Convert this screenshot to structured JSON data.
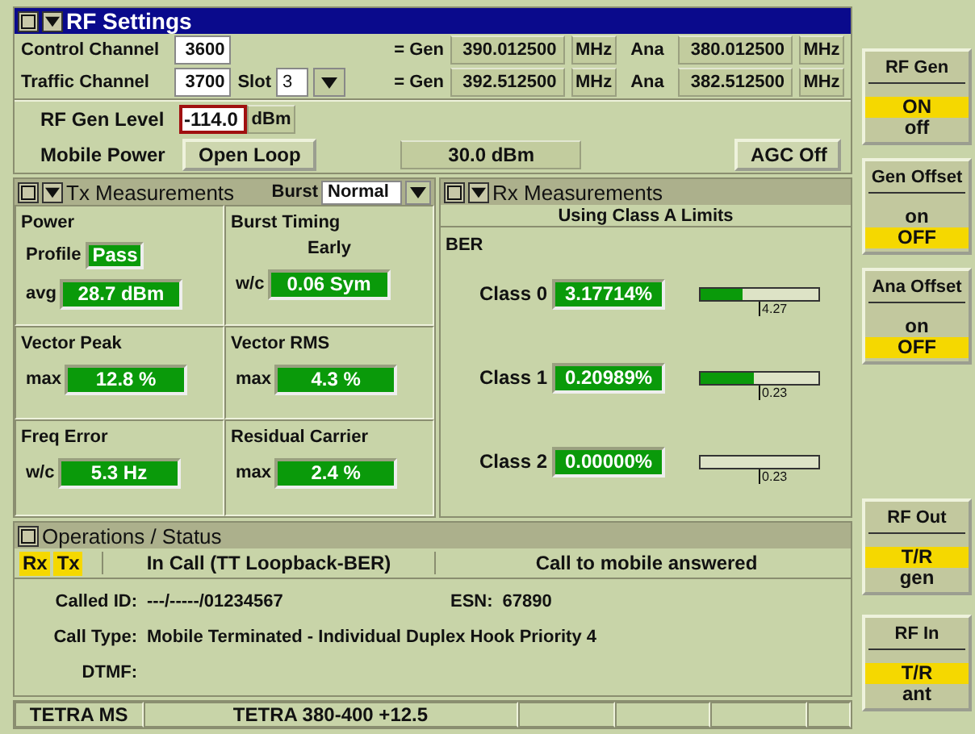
{
  "rf_settings": {
    "title": "RF Settings",
    "channels": [
      {
        "label": "Control Channel",
        "channel": "3600",
        "gen_label": "= Gen",
        "gen": "390.012500",
        "gen_unit": "MHz",
        "ana_label": "Ana",
        "ana": "380.012500",
        "ana_unit": "MHz"
      },
      {
        "label": "Traffic Channel",
        "channel": "3700",
        "slot_label": "Slot",
        "slot": "3",
        "gen_label": "= Gen",
        "gen": "392.512500",
        "gen_unit": "MHz",
        "ana_label": "Ana",
        "ana": "382.512500",
        "ana_unit": "MHz"
      }
    ],
    "gen_level": {
      "label": "RF Gen Level",
      "value": "-114.0",
      "unit": "dBm"
    },
    "mobile_power": {
      "label": "Mobile Power",
      "mode": "Open Loop",
      "reading": "30.0 dBm"
    },
    "agc_button": "AGC Off"
  },
  "tx": {
    "title": "Tx Measurements",
    "burst_label": "Burst",
    "burst": "Normal",
    "cells": [
      {
        "title": "Power",
        "lines": [
          {
            "kind": "badge",
            "label": "Profile",
            "value": "Pass"
          },
          {
            "kind": "value",
            "label": "avg",
            "value": "28.7 dBm"
          }
        ]
      },
      {
        "title": "Burst Timing",
        "lines": [
          {
            "kind": "note",
            "value": "Early"
          },
          {
            "kind": "value",
            "label": "w/c",
            "value": "0.06 Sym"
          }
        ]
      },
      {
        "title": "Vector Peak",
        "lines": [
          {
            "kind": "value",
            "label": "max",
            "value": "12.8 %"
          }
        ]
      },
      {
        "title": "Vector RMS",
        "lines": [
          {
            "kind": "value",
            "label": "max",
            "value": "4.3 %"
          }
        ]
      },
      {
        "title": "Freq Error",
        "lines": [
          {
            "kind": "value",
            "label": "w/c",
            "value": "5.3 Hz"
          }
        ]
      },
      {
        "title": "Residual Carrier",
        "lines": [
          {
            "kind": "value",
            "label": "max",
            "value": "2.4 %"
          }
        ]
      }
    ]
  },
  "rx": {
    "title": "Rx Measurements",
    "limits": "Using Class A Limits",
    "section": "BER",
    "classes": [
      {
        "label": "Class 0",
        "value": "3.17714%",
        "level": 0.36,
        "limit": "4.27"
      },
      {
        "label": "Class 1",
        "value": "0.20989%",
        "level": 0.45,
        "limit": "0.23"
      },
      {
        "label": "Class 2",
        "value": "0.00000%",
        "level": 0,
        "limit": "0.23"
      }
    ]
  },
  "operations": {
    "title": "Operations / Status",
    "indicators": [
      {
        "label": "Rx",
        "on": true
      },
      {
        "label": "Tx",
        "on": true
      }
    ],
    "state": "In Call (TT Loopback-BER)",
    "message": "Call to mobile answered",
    "lines": [
      [
        {
          "label": "Called ID:",
          "value": "---/-----/01234567"
        },
        {
          "label": "ESN:",
          "value": "67890"
        }
      ],
      [
        {
          "label": "Call Type:",
          "value": "Mobile Terminated - Individual Duplex Hook Priority 4"
        }
      ],
      [
        {
          "label": "DTMF:"
        }
      ]
    ]
  },
  "status_bar": [
    "TETRA MS",
    "TETRA 380-400 +12.5"
  ],
  "softkeys": {
    "top": [
      {
        "title": "RF Gen",
        "options": [
          {
            "label": "ON",
            "selected": true
          },
          {
            "label": "off",
            "selected": false
          }
        ]
      },
      {
        "title": "Gen Offset",
        "options": [
          {
            "label": "on",
            "selected": false
          },
          {
            "label": "OFF",
            "selected": true
          }
        ]
      },
      {
        "title": "Ana Offset",
        "options": [
          {
            "label": "on",
            "selected": false
          },
          {
            "label": "OFF",
            "selected": true
          }
        ]
      }
    ],
    "bottom": [
      {
        "title": "RF Out",
        "options": [
          {
            "label": "T/R",
            "selected": true
          },
          {
            "label": "gen",
            "selected": false
          }
        ]
      },
      {
        "title": "RF In",
        "options": [
          {
            "label": "T/R",
            "selected": true
          },
          {
            "label": "ant",
            "selected": false
          }
        ]
      }
    ]
  }
}
